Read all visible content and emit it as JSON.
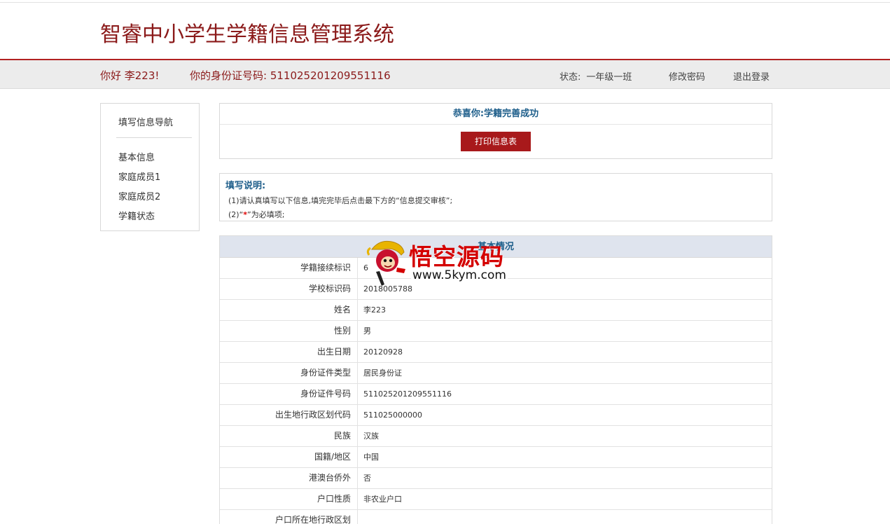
{
  "header": {
    "brand": "智睿中小学生学籍信息管理系统"
  },
  "userbar": {
    "greeting": "你好 李223!",
    "id_label": "你的身份证号码:",
    "id_number": "511025201209551116",
    "status_label": "状态:",
    "status_value": "一年级一班",
    "change_password": "修改密码",
    "logout": "退出登录"
  },
  "sidebar": {
    "title": "填写信息导航",
    "items": [
      {
        "label": "基本信息"
      },
      {
        "label": "家庭成员1"
      },
      {
        "label": "家庭成员2"
      },
      {
        "label": "学籍状态"
      }
    ]
  },
  "success": {
    "title": "恭喜你:学籍完善成功",
    "print_button": "打印信息表"
  },
  "notes": {
    "title": "填写说明:",
    "line1": "(1)请认真填写以下信息,填完完毕后点击最下方的“信息提交审核”;",
    "line2_prefix": "(2)“",
    "line2_star": "*",
    "line2_suffix": "”为必填项;"
  },
  "basic_info": {
    "title": "基本情况",
    "rows": [
      {
        "label": "学籍接续标识",
        "value": "6"
      },
      {
        "label": "学校标识码",
        "value": "2018005788"
      },
      {
        "label": "姓名",
        "value": "李223"
      },
      {
        "label": "性别",
        "value": "男"
      },
      {
        "label": "出生日期",
        "value": "20120928"
      },
      {
        "label": "身份证件类型",
        "value": "居民身份证"
      },
      {
        "label": "身份证件号码",
        "value": "511025201209551116"
      },
      {
        "label": "出生地行政区划代码",
        "value": "511025000000"
      },
      {
        "label": "民族",
        "value": "汉族"
      },
      {
        "label": "国籍/地区",
        "value": "中国"
      },
      {
        "label": "港澳台侨外",
        "value": "否"
      },
      {
        "label": "户口性质",
        "value": "非农业户口"
      },
      {
        "label": "户口所在地行政区划",
        "value": ""
      }
    ]
  },
  "watermark": {
    "text": "悟空源码",
    "url": "www.5kym.com"
  }
}
